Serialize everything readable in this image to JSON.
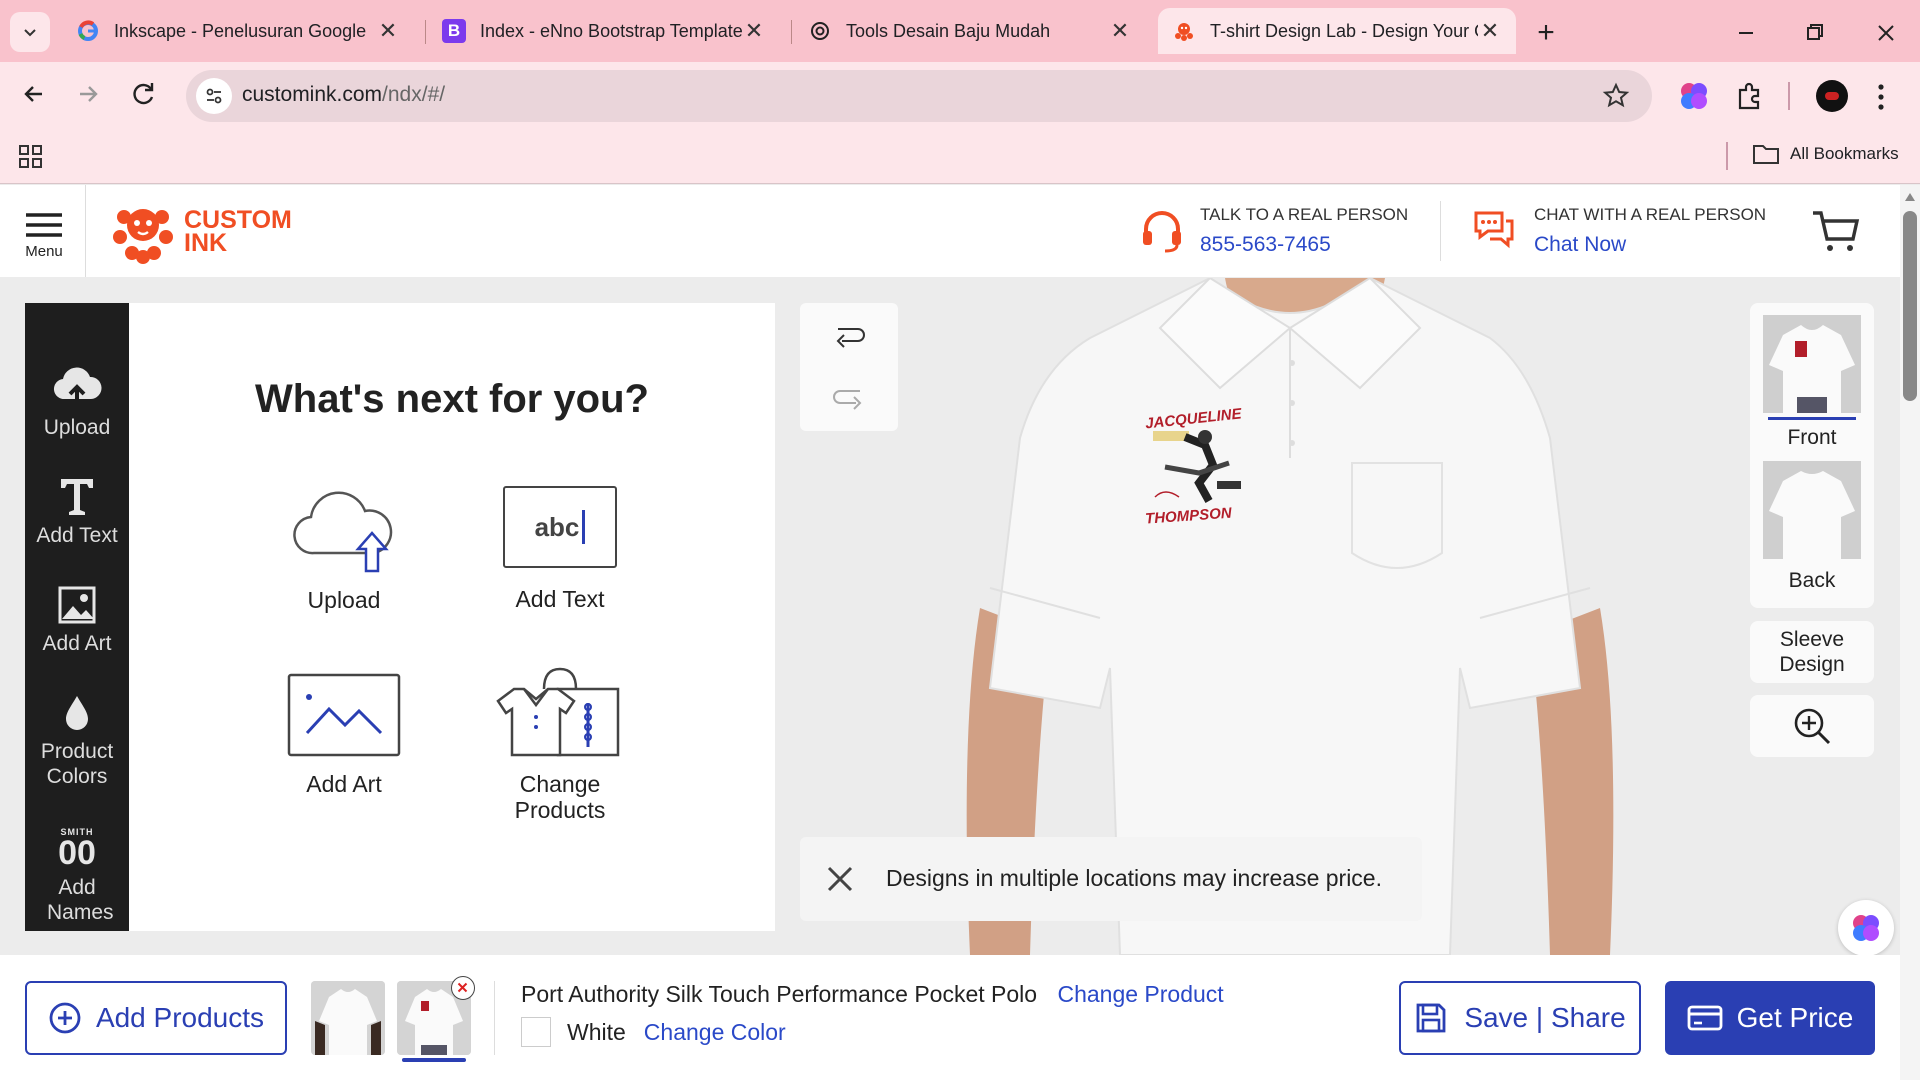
{
  "browser": {
    "tabs": [
      {
        "title": "Inkscape - Penelusuran Google",
        "icon": "google-icon"
      },
      {
        "title": "Index - eNno Bootstrap Template",
        "icon": "bootstrap-icon"
      },
      {
        "title": "Tools Desain Baju Mudah",
        "icon": "openai-icon"
      },
      {
        "title": "T-shirt Design Lab - Design Your O",
        "icon": "custom-ink-icon",
        "active": true
      }
    ],
    "url_domain": "customink.com",
    "url_path": "/ndx/#/",
    "bookmarks_label": "All Bookmarks"
  },
  "header": {
    "menu_label": "Menu",
    "logo_line1": "CUSTOM",
    "logo_line2": "INK",
    "talk_label": "TALK TO A REAL PERSON",
    "phone": "855-563-7465",
    "chat_label": "CHAT WITH A REAL PERSON",
    "chat_link": "Chat Now"
  },
  "left_nav": [
    {
      "label": "Upload",
      "icon": "cloud-upload-icon"
    },
    {
      "label": "Add Text",
      "icon": "text-icon"
    },
    {
      "label": "Add Art",
      "icon": "image-icon"
    },
    {
      "label": "Product Colors",
      "icon": "droplet-icon"
    },
    {
      "label": "Add Names",
      "icon": "names-numbers-icon",
      "badge": "SMITH",
      "number": "00"
    }
  ],
  "panel": {
    "title": "What's next for you?",
    "options": [
      {
        "label": "Upload"
      },
      {
        "label": "Add Text",
        "sample": "abc"
      },
      {
        "label": "Add Art"
      },
      {
        "label": "Change Products"
      }
    ]
  },
  "stage": {
    "design_text_top": "JACQUELINE",
    "design_text_bottom": "THOMPSON",
    "notice": "Designs in multiple locations may increase price."
  },
  "views": {
    "front": "Front",
    "back": "Back",
    "sleeve": "Sleeve Design"
  },
  "bottom": {
    "add_products": "Add Products",
    "product_name": "Port Authority Silk Touch Performance Pocket Polo",
    "change_product": "Change Product",
    "color_name": "White",
    "change_color": "Change Color",
    "save_share": "Save | Share",
    "get_price": "Get Price"
  },
  "colors": {
    "brand": "#f04e23",
    "accent": "#2a3fb3",
    "tabbar": "#f9c2cc"
  }
}
